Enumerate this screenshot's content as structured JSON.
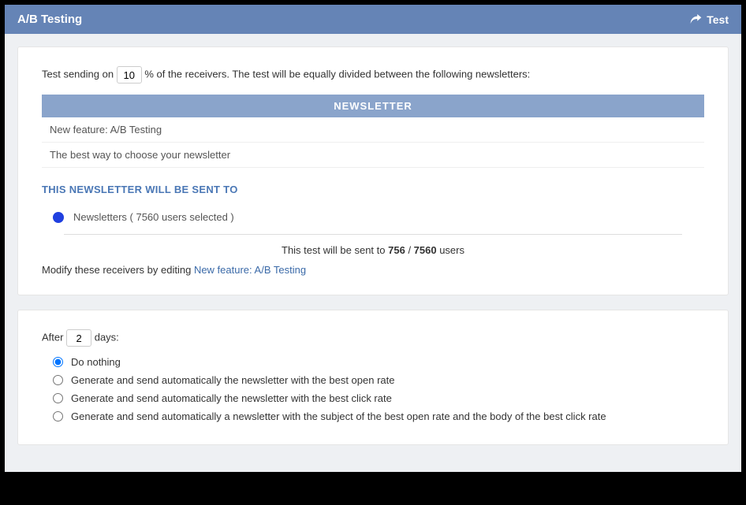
{
  "header": {
    "title": "A/B Testing",
    "test_btn": "Test"
  },
  "test_config": {
    "sentence_prefix": "Test sending on",
    "percent_value": "10",
    "sentence_suffix": "% of the receivers. The test will be equally divided between the following newsletters:"
  },
  "table": {
    "header": "NEWSLETTER",
    "rows": [
      "New feature: A/B Testing",
      "The best way to choose your newsletter"
    ]
  },
  "receivers": {
    "heading": "THIS NEWSLETTER WILL BE SENT TO",
    "item": "Newsletters ( 7560 users selected )",
    "summary_prefix": "This test will be sent to ",
    "summary_sent": "756",
    "summary_sep": " / ",
    "summary_total": "7560",
    "summary_suffix": " users",
    "modify_prefix": "Modify these receivers by editing ",
    "modify_link": "New feature: A/B Testing"
  },
  "after": {
    "prefix": "After",
    "days_value": "2",
    "suffix": "days:",
    "options": [
      "Do nothing",
      "Generate and send automatically the newsletter with the best open rate",
      "Generate and send automatically the newsletter with the best click rate",
      "Generate and send automatically a newsletter with the subject of the best open rate and the body of the best click rate"
    ]
  }
}
